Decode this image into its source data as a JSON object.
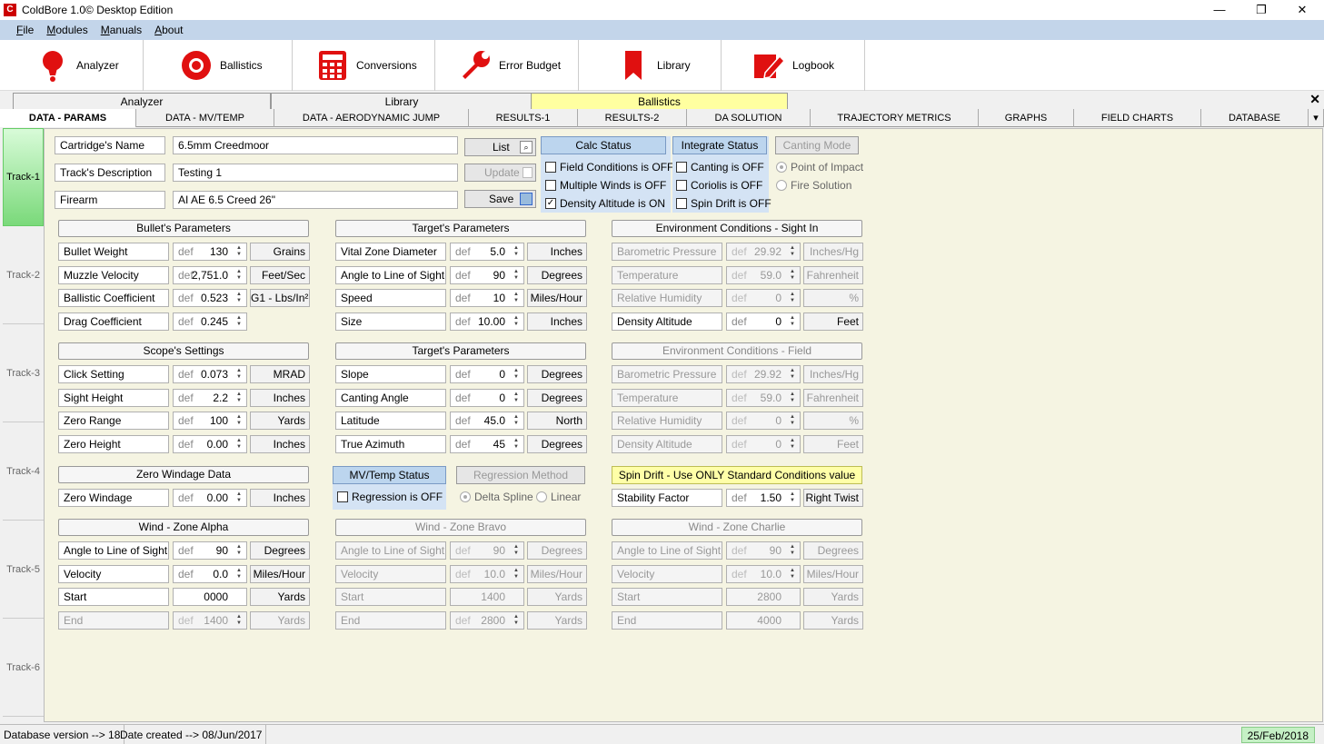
{
  "window": {
    "title": "ColdBore 1.0© Desktop Edition",
    "app_icon": "ColdBore-icon",
    "minimize": "—",
    "maximize": "❐",
    "close": "✕"
  },
  "menu": [
    "File",
    "Modules",
    "Manuals",
    "About"
  ],
  "toolbar": [
    {
      "label": "Analyzer",
      "icon": "lightbulb-icon"
    },
    {
      "label": "Ballistics",
      "icon": "target-icon"
    },
    {
      "label": "Conversions",
      "icon": "calculator-icon"
    },
    {
      "label": "Error Budget",
      "icon": "wrench-icon"
    },
    {
      "label": "Library",
      "icon": "bookmark-icon"
    },
    {
      "label": "Logbook",
      "icon": "pen-notebook-icon"
    }
  ],
  "module_tabs": [
    "Analyzer",
    "Library",
    "Ballistics"
  ],
  "module_active": "Ballistics",
  "sub_tabs": [
    "DATA - PARAMS",
    "DATA - MV/TEMP",
    "DATA - AERODYNAMIC JUMP",
    "RESULTS-1",
    "RESULTS-2",
    "DA SOLUTION",
    "TRAJECTORY METRICS",
    "GRAPHS",
    "FIELD CHARTS",
    "DATABASE"
  ],
  "tracks": [
    "Track-1",
    "Track-2",
    "Track-3",
    "Track-4",
    "Track-5",
    "Track-6"
  ],
  "header": {
    "cartridge_label": "Cartridge's Name",
    "cartridge_value": "6.5mm Creedmoor",
    "track_label": "Track's Description",
    "track_value": "Testing 1",
    "firearm_label": "Firearm",
    "firearm_value": "AI AE 6.5 Creed 26\"",
    "list": "List",
    "update": "Update",
    "save": "Save",
    "calc_status": "Calc Status",
    "integrate_status": "Integrate Status",
    "canting_mode": "Canting Mode",
    "field_conditions": "Field Conditions is OFF",
    "multiple_winds": "Multiple Winds is OFF",
    "density_altitude": "Density Altitude is ON",
    "canting": "Canting is OFF",
    "coriolis": "Coriolis is OFF",
    "spin_drift": "Spin Drift is OFF",
    "point_of_impact": "Point of Impact",
    "fire_solution": "Fire Solution"
  },
  "def": "def",
  "check": "✓",
  "spin": {
    "title": "Spin Drift - Use ONLY Standard Conditions value",
    "label": "Stability Factor",
    "value": "1.50",
    "unit": "Right Twist"
  },
  "bullet": {
    "title": "Bullet's Parameters",
    "rows": [
      {
        "label": "Bullet Weight",
        "value": "130",
        "unit": "Grains"
      },
      {
        "label": "Muzzle Velocity",
        "value": "2,751.0",
        "unit": "Feet/Sec"
      },
      {
        "label": "Ballistic Coefficient",
        "value": "0.523",
        "unit": "G1 - Lbs/In²"
      },
      {
        "label": "Drag Coefficient",
        "value": "0.245"
      }
    ]
  },
  "target1": {
    "title": "Target's Parameters",
    "rows": [
      {
        "label": "Vital Zone Diameter",
        "value": "5.0",
        "unit": "Inches"
      },
      {
        "label": "Angle to Line of Sight",
        "value": "90",
        "unit": "Degrees"
      },
      {
        "label": "Speed",
        "value": "10",
        "unit": "Miles/Hour"
      },
      {
        "label": "Size",
        "value": "10.00",
        "unit": "Inches"
      }
    ]
  },
  "env_sight": {
    "title": "Environment Conditions - Sight In",
    "rows": [
      {
        "label": "Barometric Pressure",
        "value": "29.92",
        "unit": "Inches/Hg"
      },
      {
        "label": "Temperature",
        "value": "59.0",
        "unit": "Fahrenheit"
      },
      {
        "label": "Relative Humidity",
        "value": "0",
        "unit": "%"
      },
      {
        "label": "Density Altitude",
        "value": "0",
        "unit": "Feet"
      }
    ]
  },
  "scope": {
    "title": "Scope's Settings",
    "rows": [
      {
        "label": "Click Setting",
        "value": "0.073",
        "unit": "MRAD"
      },
      {
        "label": "Sight Height",
        "value": "2.2",
        "unit": "Inches"
      },
      {
        "label": "Zero Range",
        "value": "100",
        "unit": "Yards"
      },
      {
        "label": "Zero Height",
        "value": "0.00",
        "unit": "Inches"
      }
    ]
  },
  "target2": {
    "title": "Target's Parameters",
    "rows": [
      {
        "label": "Slope",
        "value": "0",
        "unit": "Degrees"
      },
      {
        "label": "Canting Angle",
        "value": "0",
        "unit": "Degrees"
      },
      {
        "label": "Latitude",
        "value": "45.0",
        "unit": "North"
      },
      {
        "label": "True Azimuth",
        "value": "45",
        "unit": "Degrees"
      }
    ]
  },
  "env_field": {
    "title": "Environment Conditions - Field",
    "rows": [
      {
        "label": "Barometric Pressure",
        "value": "29.92",
        "unit": "Inches/Hg"
      },
      {
        "label": "Temperature",
        "value": "59.0",
        "unit": "Fahrenheit"
      },
      {
        "label": "Relative Humidity",
        "value": "0",
        "unit": "%"
      },
      {
        "label": "Density Altitude",
        "value": "0",
        "unit": "Feet"
      }
    ]
  },
  "zero_windage": {
    "title": "Zero Windage Data",
    "label": "Zero Windage",
    "value": "0.00",
    "unit": "Inches"
  },
  "mvtemp": {
    "status": "MV/Temp Status",
    "regression_method": "Regression Method",
    "regression": "Regression is OFF",
    "delta_spline": "Delta Spline",
    "linear": "Linear"
  },
  "wind_alpha": {
    "title": "Wind - Zone Alpha",
    "rows": [
      {
        "label": "Angle to Line of Sight",
        "value": "90",
        "unit": "Degrees"
      },
      {
        "label": "Velocity",
        "value": "0.0",
        "unit": "Miles/Hour"
      },
      {
        "label": "Start",
        "value": "0000",
        "unit": "Yards"
      },
      {
        "label": "End",
        "value": "1400",
        "unit": "Yards"
      }
    ]
  },
  "wind_bravo": {
    "title": "Wind - Zone Bravo",
    "rows": [
      {
        "label": "Angle to Line of Sight",
        "value": "90",
        "unit": "Degrees"
      },
      {
        "label": "Velocity",
        "value": "10.0",
        "unit": "Miles/Hour"
      },
      {
        "label": "Start",
        "value": "1400",
        "unit": "Yards"
      },
      {
        "label": "End",
        "value": "2800",
        "unit": "Yards"
      }
    ]
  },
  "wind_charlie": {
    "title": "Wind - Zone Charlie",
    "rows": [
      {
        "label": "Angle to Line of Sight",
        "value": "90",
        "unit": "Degrees"
      },
      {
        "label": "Velocity",
        "value": "10.0",
        "unit": "Miles/Hour"
      },
      {
        "label": "Start",
        "value": "2800",
        "unit": "Yards"
      },
      {
        "label": "End",
        "value": "4000",
        "unit": "Yards"
      }
    ]
  },
  "status": {
    "db_version": "Database version --> 18",
    "date_created": "Date created --> 08/Jun/2017",
    "today": "25/Feb/2018"
  }
}
